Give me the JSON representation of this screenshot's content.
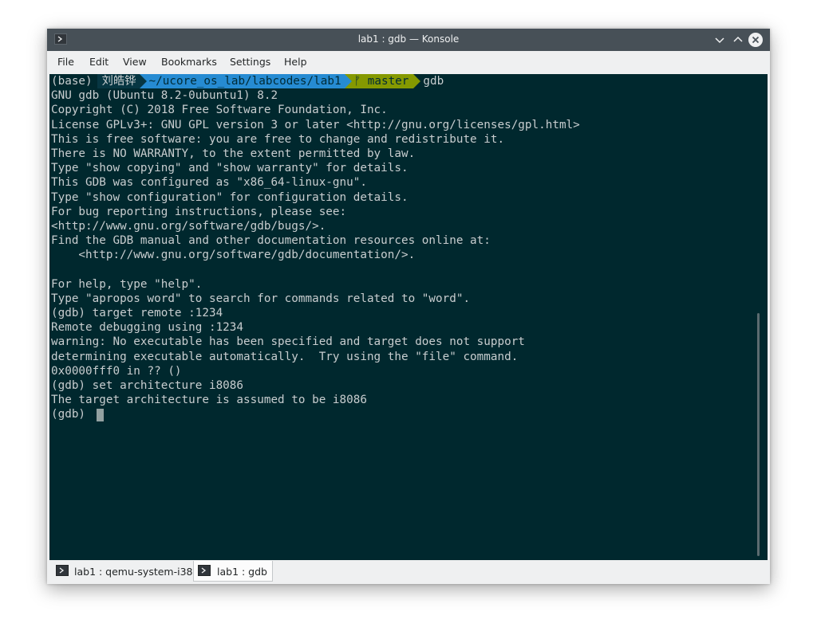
{
  "window": {
    "title": "lab1 : gdb — Konsole"
  },
  "menu": [
    "File",
    "Edit",
    "View",
    "Bookmarks",
    "Settings",
    "Help"
  ],
  "prompt": {
    "env": "(base)",
    "user": "刘皓铧",
    "dir": "~/ucore_os_lab/labcodes/lab1",
    "git_branch": "ᚠ master",
    "command": "gdb"
  },
  "terminal_lines": [
    "GNU gdb (Ubuntu 8.2-0ubuntu1) 8.2",
    "Copyright (C) 2018 Free Software Foundation, Inc.",
    "License GPLv3+: GNU GPL version 3 or later <http://gnu.org/licenses/gpl.html>",
    "This is free software: you are free to change and redistribute it.",
    "There is NO WARRANTY, to the extent permitted by law.",
    "Type \"show copying\" and \"show warranty\" for details.",
    "This GDB was configured as \"x86_64-linux-gnu\".",
    "Type \"show configuration\" for configuration details.",
    "For bug reporting instructions, please see:",
    "<http://www.gnu.org/software/gdb/bugs/>.",
    "Find the GDB manual and other documentation resources online at:",
    "    <http://www.gnu.org/software/gdb/documentation/>.",
    "",
    "For help, type \"help\".",
    "Type \"apropos word\" to search for commands related to \"word\".",
    "(gdb) target remote :1234",
    "Remote debugging using :1234",
    "warning: No executable has been specified and target does not support",
    "determining executable automatically.  Try using the \"file\" command.",
    "0x0000fff0 in ?? ()",
    "(gdb) set architecture i8086",
    "The target architecture is assumed to be i8086",
    "(gdb) "
  ],
  "tabs": [
    {
      "label": "lab1 : qemu-system-i38",
      "active": false
    },
    {
      "label": "lab1 : gdb",
      "active": true
    }
  ],
  "colors": {
    "terminal_bg": "#00282e",
    "terminal_fg": "#c8cdcf",
    "titlebar_bg": "#475057",
    "prompt_user_bg": "#073642",
    "prompt_dir_bg": "#268bd2",
    "prompt_git_bg": "#859900"
  }
}
